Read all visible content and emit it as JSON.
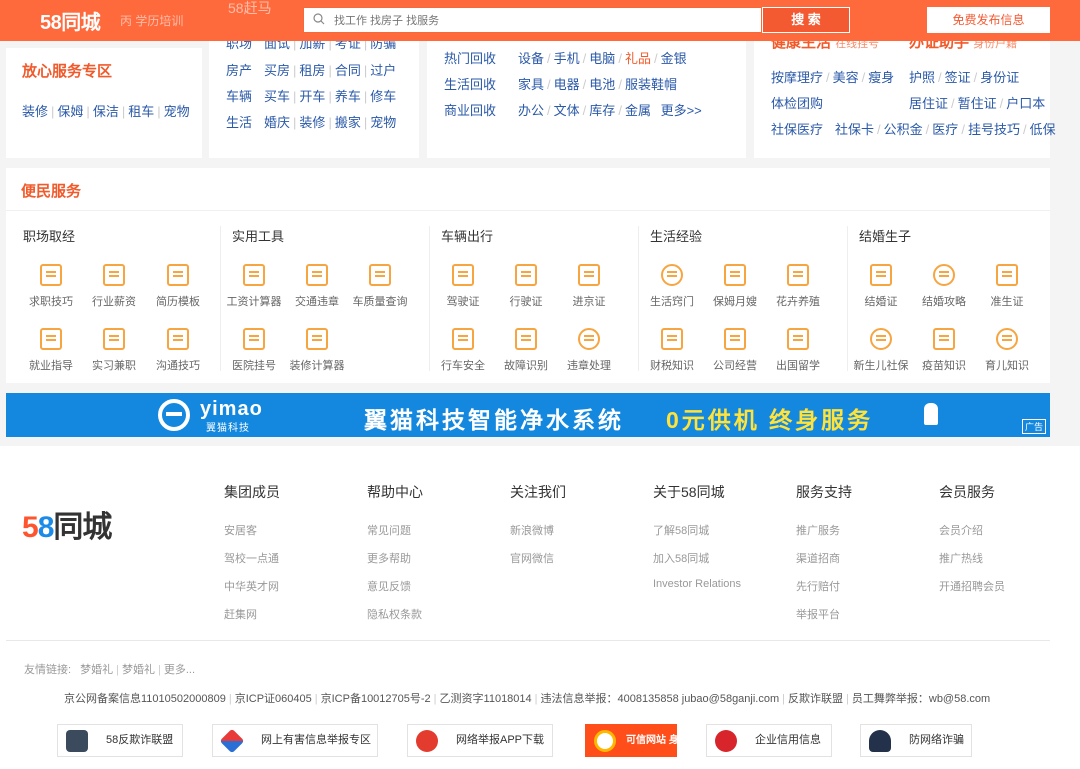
{
  "header": {
    "logo": "58同城",
    "behind_text": "丙 学历培训",
    "behind_text2": "58赶马",
    "search_placeholder": "找工作 找房子 找服务",
    "search_button": "搜 索",
    "publish_button": "免费发布信息"
  },
  "card1": {
    "title": "放心服务专区",
    "links": [
      "装修",
      "保姆",
      "保洁",
      "租车",
      "宠物"
    ]
  },
  "card2": {
    "rows": [
      {
        "lead": "职场",
        "items": [
          "面试",
          "加薪",
          "考证",
          "防骗"
        ]
      },
      {
        "lead": "房产",
        "items": [
          "买房",
          "租房",
          "合同",
          "过户"
        ]
      },
      {
        "lead": "车辆",
        "items": [
          "买车",
          "开车",
          "养车",
          "修车"
        ]
      },
      {
        "lead": "生活",
        "items": [
          "婚庆",
          "装修",
          "搬家",
          "宠物"
        ]
      }
    ]
  },
  "card3": {
    "rows": [
      {
        "lead": "热门回收",
        "items": [
          "设备",
          "手机",
          "电脑",
          "礼品",
          "金银"
        ]
      },
      {
        "lead": "生活回收",
        "items": [
          "家具",
          "电器",
          "电池",
          "服装鞋帽"
        ]
      },
      {
        "lead": "商业回收",
        "items": [
          "办公",
          "文体",
          "库存",
          "金属",
          "更多>>"
        ]
      }
    ]
  },
  "card4": {
    "title_left": "健康生活",
    "title_left_sub": "在线挂号",
    "title_right": "办证助手",
    "title_right_sub": "身份户籍",
    "rows": [
      {
        "left": [
          "按摩理疗",
          "美容",
          "瘦身"
        ],
        "right": [
          "护照",
          "签证",
          "身份证"
        ]
      },
      {
        "left": [
          "体检团购"
        ],
        "right": [
          "居住证",
          "暂住证",
          "户口本"
        ]
      },
      {
        "left": [
          "社保医疗"
        ],
        "right": [
          "社保卡",
          "公积金",
          "医疗",
          "挂号技巧",
          "低保"
        ]
      }
    ]
  },
  "services": {
    "title": "便民服务",
    "groups": [
      {
        "name": "职场取经",
        "items": [
          "求职技巧",
          "行业薪资",
          "简历模板",
          "就业指导",
          "实习兼职",
          "沟通技巧"
        ]
      },
      {
        "name": "实用工具",
        "items": [
          "工资计算器",
          "交通违章",
          "车质量查询",
          "医院挂号",
          "装修计算器"
        ]
      },
      {
        "name": "车辆出行",
        "items": [
          "驾驶证",
          "行驶证",
          "进京证",
          "行车安全",
          "故障识别",
          "违章处理"
        ]
      },
      {
        "name": "生活经验",
        "items": [
          "生活窍门",
          "保姆月嫂",
          "花卉养殖",
          "财税知识",
          "公司经营",
          "出国留学"
        ]
      },
      {
        "name": "结婚生子",
        "items": [
          "结婚证",
          "结婚攻略",
          "准生证",
          "新生儿社保",
          "疫苗知识",
          "育儿知识"
        ]
      }
    ]
  },
  "ad": {
    "brand": "yimao",
    "brand_cn": "翼猫科技",
    "slogan": "翼猫科技智能净水系统",
    "slogan_highlight": "0元供机 终身服务",
    "tag": "广告"
  },
  "footer": {
    "logo_5": "5",
    "logo_8": "8",
    "logo_rest": "同城",
    "columns": [
      {
        "title": "集团成员",
        "links": [
          "安居客",
          "驾校一点通",
          "中华英才网",
          "赶集网"
        ]
      },
      {
        "title": "帮助中心",
        "links": [
          "常见问题",
          "更多帮助",
          "意见反馈",
          "隐私权条款"
        ]
      },
      {
        "title": "关注我们",
        "links": [
          "新浪微博",
          "官网微信"
        ]
      },
      {
        "title": "关于58同城",
        "links": [
          "了解58同城",
          "加入58同城",
          "Investor Relations"
        ]
      },
      {
        "title": "服务支持",
        "links": [
          "推广服务",
          "渠道招商",
          "先行赔付",
          "举报平台"
        ]
      },
      {
        "title": "会员服务",
        "links": [
          "会员介绍",
          "推广热线",
          "开通招聘会员"
        ]
      }
    ],
    "friends_label": "友情链接:",
    "friends": [
      "梦婚礼",
      "梦婚礼",
      "更多..."
    ],
    "beian": [
      "京公网备案信息11010502000809",
      "京ICP证060405",
      "京ICP备10012705号-2",
      "乙测资字11018014",
      "违法信息举报：4008135858 jubao@58ganji.com",
      "反欺诈联盟",
      "员工舞弊举报：wb@58.com"
    ],
    "badges": [
      "58反欺诈联盟",
      "网上有害信息举报专区",
      "网络举报APP下载",
      "可信网站 身份验证",
      "企业信用信息",
      "防网络诈骗"
    ]
  },
  "colors": {
    "header_orange": "#ff6a3d",
    "accent_orange": "#f15a2b",
    "link_blue": "#2a59a8",
    "icon_orange": "#f7a541",
    "ad_blue": "#1488de"
  }
}
